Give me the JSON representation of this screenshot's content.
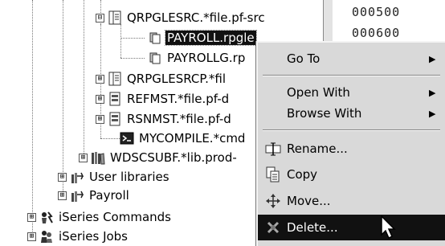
{
  "tree": {
    "items": [
      {
        "label": "QRPGLESRC.*file.pf-src",
        "expander": "⊟"
      },
      {
        "label": "PAYROLL.rpgle"
      },
      {
        "label": "PAYROLLG.rp"
      },
      {
        "label": "QRPGLESRCP.*fil",
        "expander": "⊞"
      },
      {
        "label": "REFMST.*file.pf-d",
        "expander": "⊞"
      },
      {
        "label": "RSNMST.*file.pf-d",
        "expander": "⊞"
      },
      {
        "label": "MYCOMPILE.*cmd"
      },
      {
        "label": "WDSCSUBF.*lib.prod-",
        "expander": "⊞"
      },
      {
        "label": "User libraries",
        "expander": "⊞"
      },
      {
        "label": "Payroll",
        "expander": "⊞"
      },
      {
        "label": "iSeries Commands",
        "expander": "⊞"
      },
      {
        "label": "iSeries Jobs",
        "expander": "⊞"
      }
    ]
  },
  "editor": {
    "line_numbers": [
      "000500",
      "000600"
    ]
  },
  "context_menu": {
    "items": [
      {
        "label": "Go To",
        "submenu": "▶"
      },
      {
        "label": "Open With",
        "submenu": "▶"
      },
      {
        "label": "Browse With",
        "submenu": "▶"
      },
      {
        "label": "Rename..."
      },
      {
        "label": "Copy"
      },
      {
        "label": "Move..."
      },
      {
        "label": "Delete..."
      }
    ],
    "highlighted": "Delete..."
  }
}
